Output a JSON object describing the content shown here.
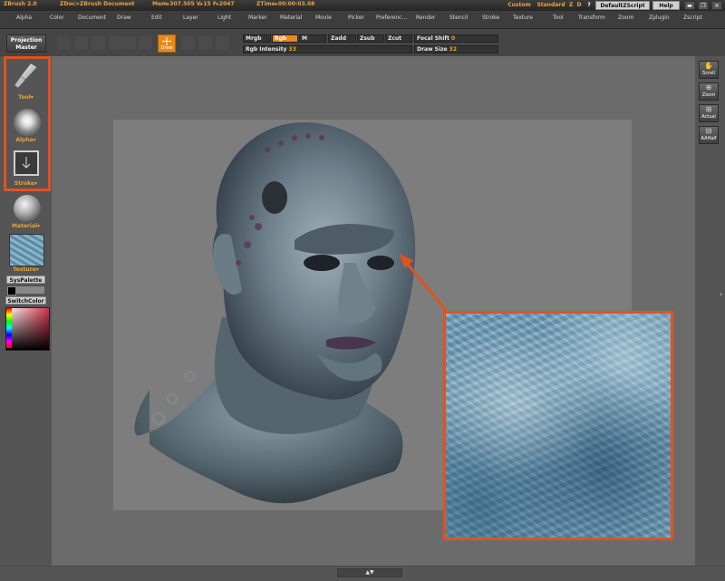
{
  "colors": {
    "accent": "#e8891f",
    "callout_border": "#e2521f",
    "panel": "#555555",
    "canvas": "#7d7d7d"
  },
  "titlebar": {
    "app": "ZBrush 2.0",
    "doc": "ZDoc>ZBrush Document",
    "stats": "Mem▸307.505 V▸15 F▸2047",
    "ztime": "ZTime▸00:00:03.08",
    "custom": "Custom",
    "standard": "Standard",
    "z": "Z",
    "d": "D",
    "question": "?",
    "script": "DefaultZScript",
    "help": "Help"
  },
  "menu": [
    "Alpha",
    "Color",
    "Document",
    "Draw",
    "Edit",
    "Layer",
    "Light",
    "Marker",
    "Material",
    "Movie",
    "Picker",
    "Preferenc…",
    "Render",
    "Stencil",
    "Stroke",
    "Texture",
    "Tool",
    "Transform",
    "Zoom",
    "Zplugin",
    "Zscript"
  ],
  "shelf": {
    "projection_master_1": "Projection",
    "projection_master_2": "Master",
    "draw_label": "Draw",
    "mrgb": "Mrgb",
    "rgb": "Rgb",
    "m": "M",
    "zadd": "Zadd",
    "zsub": "Zsub",
    "zcut": "Zcut",
    "focal_label": "Focal Shift",
    "focal_value": "0",
    "rgb_int_label": "Rgb Intensity",
    "rgb_int_value": "33",
    "draw_size_label": "Draw Size",
    "draw_size_value": "32"
  },
  "leftpanel": {
    "tool": "Tool",
    "alpha": "Alpha",
    "stroke": "Stroke",
    "material": "Material",
    "texture": "Texture",
    "syspalette": "SysPalette",
    "switchcolor": "SwitchColor"
  },
  "rightpanel": {
    "scroll": "Scroll",
    "zoom": "Zoom",
    "actual": "Actual",
    "aahalf": "AAHalf"
  },
  "icons": [
    "brush-icon",
    "alpha-sphere-icon",
    "stroke-icon",
    "material-sphere-icon",
    "texture-thumbnail",
    "color-picker",
    "scroll-icon",
    "zoom-icon",
    "actual-icon",
    "aahalf-icon",
    "minimize-icon",
    "restore-icon",
    "close-icon"
  ]
}
